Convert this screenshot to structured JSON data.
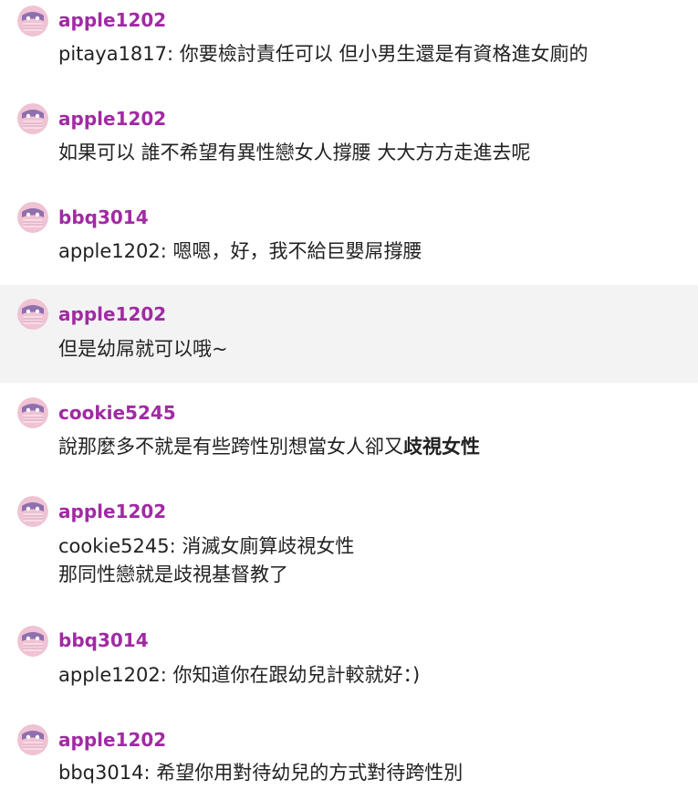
{
  "colors": {
    "username": "#a12aa3",
    "text": "#222222",
    "highlight_bg": "#f3f3f4",
    "avatar_bg": "#efc2d4",
    "avatar_face": "#8f6fae"
  },
  "avatar_icon": "masked-face-icon",
  "comments": [
    {
      "username": "apple1202",
      "mention": "pitaya1817",
      "text": "你要檢討責任可以 但小男生還是有資格進女廁的"
    },
    {
      "username": "apple1202",
      "text": "如果可以 誰不希望有異性戀女人撐腰 大大方方走進去呢"
    },
    {
      "username": "bbq3014",
      "mention": "apple1202",
      "text": "嗯嗯，好，我不給巨嬰屌撐腰"
    },
    {
      "username": "apple1202",
      "text": "但是幼屌就可以哦~",
      "highlighted": true
    },
    {
      "username": "cookie5245",
      "text": "說那麼多不就是有些跨性別想當女人卻又",
      "text_bold": "歧視女性"
    },
    {
      "username": "apple1202",
      "mention": "cookie5245",
      "text": "消滅女廁算歧視女性",
      "text_line2": "那同性戀就是歧視基督教了"
    },
    {
      "username": "bbq3014",
      "mention": "apple1202",
      "text": "你知道你在跟幼兒計較就好：)"
    },
    {
      "username": "apple1202",
      "mention": "bbq3014",
      "text": "希望你用對待幼兒的方式對待跨性別"
    }
  ]
}
